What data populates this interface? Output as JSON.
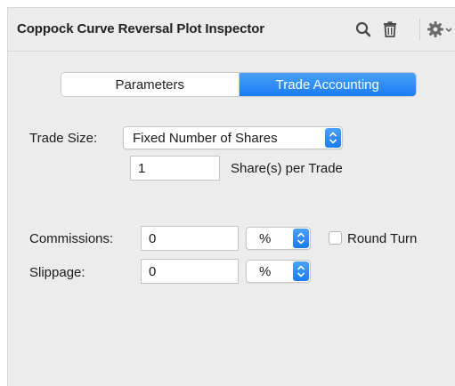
{
  "header": {
    "title": "Coppock Curve Reversal Plot Inspector",
    "icons": [
      "search-icon",
      "trash-icon",
      "gear-icon",
      "chevron-down-icon"
    ]
  },
  "tabs": {
    "items": [
      {
        "label": "Parameters",
        "active": false
      },
      {
        "label": "Trade Accounting",
        "active": true
      }
    ]
  },
  "trade_size": {
    "label": "Trade Size:",
    "selected": "Fixed Number of Shares",
    "quantity": "1",
    "unit_label": "Share(s) per Trade"
  },
  "commissions": {
    "label": "Commissions:",
    "value": "0",
    "unit": "%",
    "round_turn_label": "Round Turn",
    "round_turn_checked": false
  },
  "slippage": {
    "label": "Slippage:",
    "value": "0",
    "unit": "%"
  },
  "colors": {
    "accent": "#1a7cf3",
    "panel_bg": "#ececec"
  }
}
